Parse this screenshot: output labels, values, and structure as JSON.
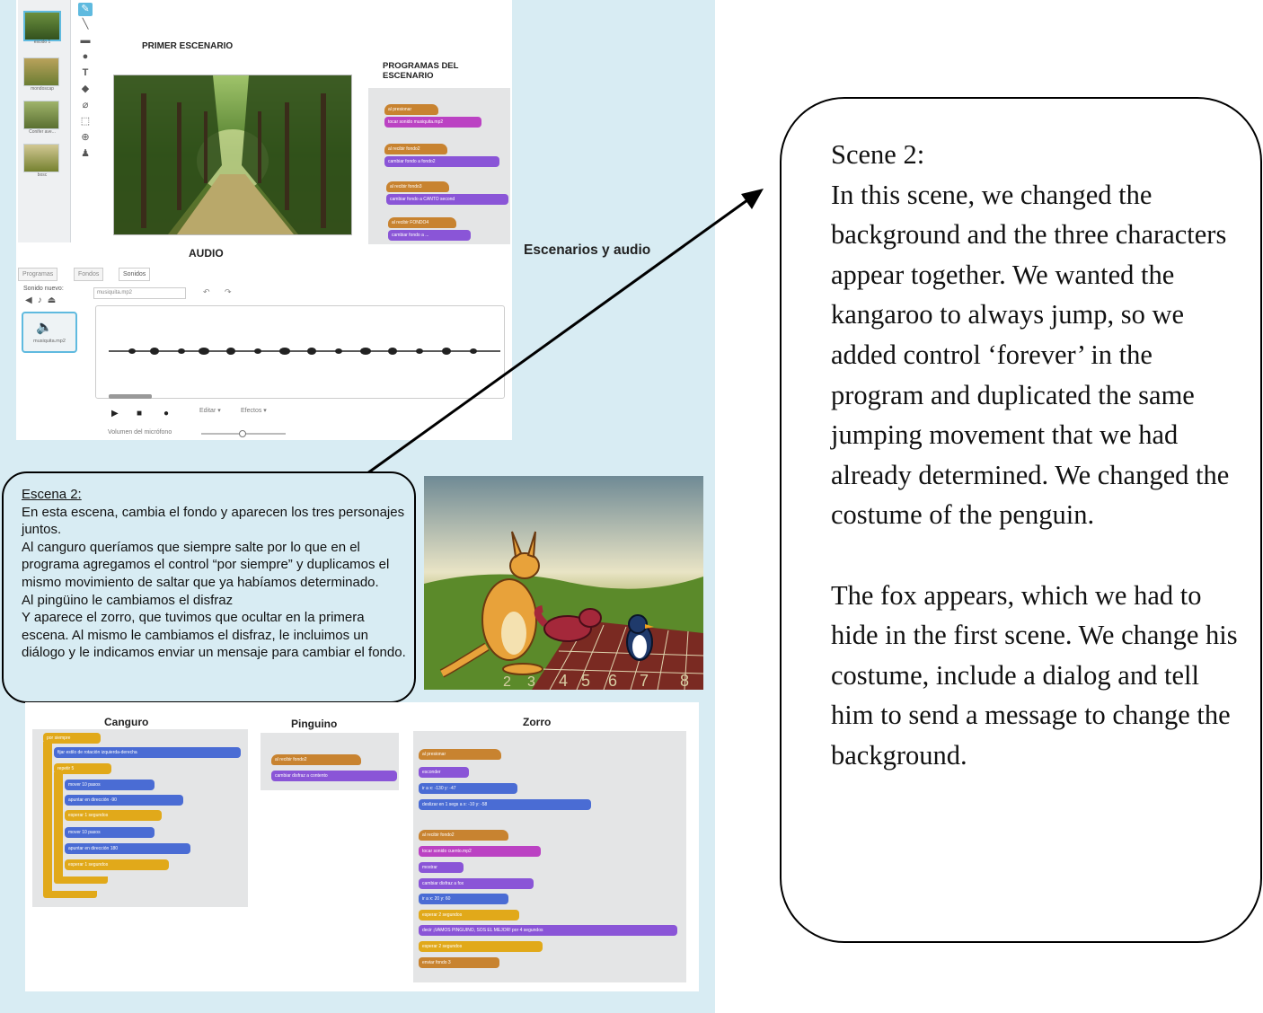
{
  "editor": {
    "stage_caption": "PRIMER ESCENARIO",
    "scripts_caption": "PROGRAMAS DEL ESCENARIO",
    "audio_caption": "AUDIO",
    "side_caption": "Escenarios y audio",
    "tabs": [
      "Programas",
      "Fondos",
      "Sonidos"
    ],
    "new_sound_label": "Sonido nuevo:",
    "sound_name_value": "musiquita.mp2",
    "sound_thumb_caption": "musiquita.mp2",
    "edit_menu": "Editar ▾",
    "effects_menu": "Efectos ▾",
    "mic_volume_label": "Volumen del micrófono",
    "backdrops": [
      {
        "caption": "escido 1"
      },
      {
        "caption": "mondoscap"
      },
      {
        "caption": "Conifer ave..."
      },
      {
        "caption": "bosc"
      }
    ],
    "stage_scripts": [
      {
        "hat": "al presionar",
        "body": "tocar sonido musiquita.mp2"
      },
      {
        "hat": "al recibir fondo2",
        "body": "cambiar fondo a fondo2"
      },
      {
        "hat": "al recibir fondo3",
        "body": "cambiar fondo a CANTO second"
      },
      {
        "hat": "al recibir FONDO4",
        "body": "cambiar fondo a ..."
      }
    ]
  },
  "callout_es": {
    "title": "Escena 2:",
    "body": "En esta escena, cambia el fondo y aparecen los tres personajes juntos.\nAl canguro queríamos que siempre salte por lo que en el programa agregamos el control “por siempre” y duplicamos el mismo movimiento de saltar que ya habíamos determinado.\nAl pingüino le cambiamos el disfraz\nY aparece el zorro, que tuvimos que ocultar en la primera escena. Al mismo le cambiamos el disfraz, le incluimos un diálogo y le indicamos enviar un mensaje para cambiar el fondo."
  },
  "scene_track_numbers": [
    "2",
    "3",
    "4",
    "5",
    "6",
    "7",
    "8"
  ],
  "sprites": {
    "kangaroo": {
      "title": "Canguro",
      "blocks": [
        {
          "text": "por siempre",
          "cat": "control"
        },
        {
          "text": "fijar estilo de rotación izquierda-derecha",
          "cat": "motion"
        },
        {
          "text": "repetir 5",
          "cat": "control"
        },
        {
          "text": "mover 10 pasos",
          "cat": "motion"
        },
        {
          "text": "apuntar en dirección -90",
          "cat": "motion"
        },
        {
          "text": "esperar 1 segundos",
          "cat": "control"
        },
        {
          "text": "mover 10 pasos",
          "cat": "motion"
        },
        {
          "text": "apuntar en dirección 180",
          "cat": "motion"
        },
        {
          "text": "esperar 1 segundos",
          "cat": "control"
        }
      ]
    },
    "penguin": {
      "title": "Pinguino",
      "blocks": [
        {
          "text": "al recibir fondo2",
          "cat": "events"
        },
        {
          "text": "cambiar disfraz a contento",
          "cat": "looks"
        }
      ]
    },
    "fox": {
      "title": "Zorro",
      "blocks": [
        {
          "text": "al presionar",
          "cat": "events"
        },
        {
          "text": "esconder",
          "cat": "looks"
        },
        {
          "text": "ir a x: -130 y: -47",
          "cat": "motion"
        },
        {
          "text": "deslizar en 1 segs a x: -10 y: -58",
          "cat": "motion"
        },
        {
          "text": "al recibir fondo2",
          "cat": "events"
        },
        {
          "text": "tocar sonido cuento.mp2",
          "cat": "sound"
        },
        {
          "text": "mostrar",
          "cat": "looks"
        },
        {
          "text": "cambiar disfraz a fox",
          "cat": "looks"
        },
        {
          "text": "ir a x: 20 y: 60",
          "cat": "motion"
        },
        {
          "text": "esperar 2 segundos",
          "cat": "control"
        },
        {
          "text": "decir ¡VAMOS PINGUINO, SOS EL MEJOR! por 4 segundos",
          "cat": "looks"
        },
        {
          "text": "esperar 2 segundos",
          "cat": "control"
        },
        {
          "text": "enviar fondo 3",
          "cat": "events"
        }
      ]
    }
  },
  "callout_en": {
    "title": "Scene 2:",
    "para1": "In this scene, we changed the background and the three characters appear together. We wanted the kangaroo to always jump, so we added control ‘forever’ in the program and duplicated the same jumping movement that we had already determined. We changed the costume of the penguin.",
    "para2": "The fox appears, which we had to hide in the first scene. We change his costume, include a dialog and tell him to send a message to change the background."
  },
  "colors": {
    "panel_bg": "#d8ecf3",
    "events": "#c88330",
    "looks": "#8a55d7",
    "sound": "#bb42c3",
    "motion": "#4a6cd4",
    "control": "#e1a91a"
  },
  "icons": [
    "brush-icon",
    "line-icon",
    "rectangle-icon",
    "ellipse-icon",
    "text-icon",
    "fill-icon",
    "eraser-icon",
    "select-icon",
    "zoom-icon",
    "stamp-icon",
    "speaker-icon",
    "microphone-icon",
    "play-icon",
    "stop-icon",
    "record-icon",
    "arrow-icon"
  ]
}
